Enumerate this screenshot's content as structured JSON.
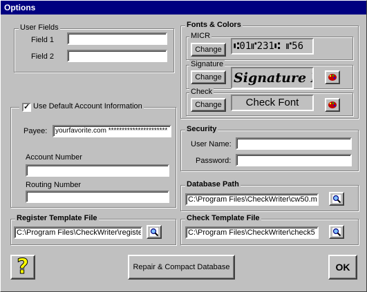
{
  "window": {
    "title": "Options"
  },
  "user_fields": {
    "title": "User Fields",
    "field1_label": "Field 1",
    "field1_value": "",
    "field2_label": "Field 2",
    "field2_value": ""
  },
  "account": {
    "checkbox_label": "Use Default Account Information",
    "checked": "✓",
    "payee_label": "Payee:",
    "payee_value": "yourfavorite.com **********************",
    "account_number_label": "Account Number",
    "account_number_value": "",
    "routing_number_label": "Routing Number",
    "routing_number_value": ""
  },
  "fonts_colors": {
    "title": "Fonts & Colors",
    "micr_label": "MICR",
    "micr_change": "Change",
    "micr_preview": "⑆01⑈231⑆ ⑈56",
    "signature_label": "Signature",
    "signature_change": "Change",
    "signature_preview": "Signature F",
    "check_label": "Check",
    "check_change": "Change",
    "check_preview": "Check Font",
    "color_icon": "color-palette-icon"
  },
  "security": {
    "title": "Security",
    "username_label": "User Name:",
    "username_value": "",
    "password_label": "Password:",
    "password_value": ""
  },
  "database": {
    "title": "Database Path",
    "path_value": "C:\\Program Files\\CheckWriter\\cw50.m"
  },
  "register_template": {
    "title": "Register Template File",
    "path_value": "C:\\Program Files\\CheckWriter\\registe"
  },
  "check_template": {
    "title": "Check Template File",
    "path_value": "C:\\Program Files\\CheckWriter\\check5"
  },
  "footer": {
    "help_icon": "help-question-icon",
    "help_glyph": "?",
    "repair_label": "Repair & Compact Database",
    "ok_label": "OK"
  },
  "colors": {
    "titlebar": "#000080",
    "face": "#c0c0c0",
    "help_yellow": "#ffff00",
    "palette_red": "#c00000"
  }
}
